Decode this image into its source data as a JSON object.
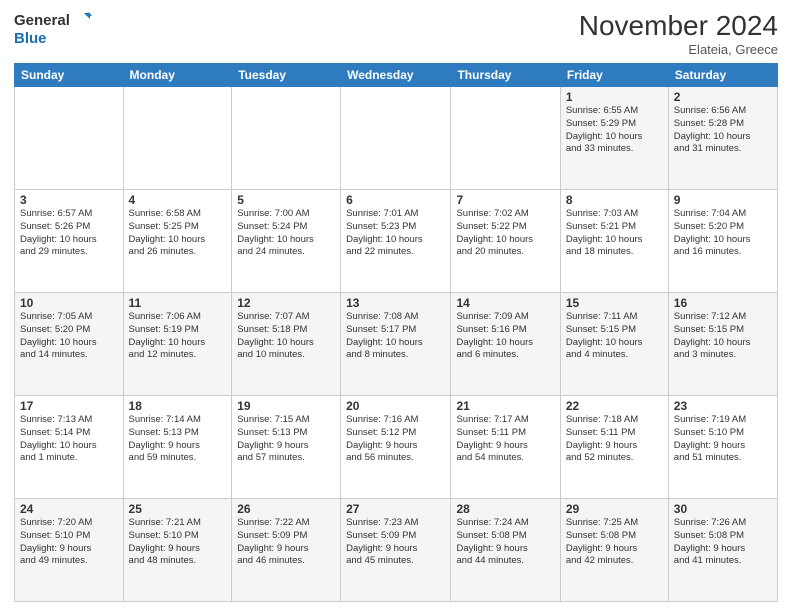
{
  "logo": {
    "line1": "General",
    "line2": "Blue"
  },
  "title": "November 2024",
  "location": "Elateia, Greece",
  "days_header": [
    "Sunday",
    "Monday",
    "Tuesday",
    "Wednesday",
    "Thursday",
    "Friday",
    "Saturday"
  ],
  "weeks": [
    [
      {
        "day": "",
        "info": ""
      },
      {
        "day": "",
        "info": ""
      },
      {
        "day": "",
        "info": ""
      },
      {
        "day": "",
        "info": ""
      },
      {
        "day": "",
        "info": ""
      },
      {
        "day": "1",
        "info": "Sunrise: 6:55 AM\nSunset: 5:29 PM\nDaylight: 10 hours\nand 33 minutes."
      },
      {
        "day": "2",
        "info": "Sunrise: 6:56 AM\nSunset: 5:28 PM\nDaylight: 10 hours\nand 31 minutes."
      }
    ],
    [
      {
        "day": "3",
        "info": "Sunrise: 6:57 AM\nSunset: 5:26 PM\nDaylight: 10 hours\nand 29 minutes."
      },
      {
        "day": "4",
        "info": "Sunrise: 6:58 AM\nSunset: 5:25 PM\nDaylight: 10 hours\nand 26 minutes."
      },
      {
        "day": "5",
        "info": "Sunrise: 7:00 AM\nSunset: 5:24 PM\nDaylight: 10 hours\nand 24 minutes."
      },
      {
        "day": "6",
        "info": "Sunrise: 7:01 AM\nSunset: 5:23 PM\nDaylight: 10 hours\nand 22 minutes."
      },
      {
        "day": "7",
        "info": "Sunrise: 7:02 AM\nSunset: 5:22 PM\nDaylight: 10 hours\nand 20 minutes."
      },
      {
        "day": "8",
        "info": "Sunrise: 7:03 AM\nSunset: 5:21 PM\nDaylight: 10 hours\nand 18 minutes."
      },
      {
        "day": "9",
        "info": "Sunrise: 7:04 AM\nSunset: 5:20 PM\nDaylight: 10 hours\nand 16 minutes."
      }
    ],
    [
      {
        "day": "10",
        "info": "Sunrise: 7:05 AM\nSunset: 5:20 PM\nDaylight: 10 hours\nand 14 minutes."
      },
      {
        "day": "11",
        "info": "Sunrise: 7:06 AM\nSunset: 5:19 PM\nDaylight: 10 hours\nand 12 minutes."
      },
      {
        "day": "12",
        "info": "Sunrise: 7:07 AM\nSunset: 5:18 PM\nDaylight: 10 hours\nand 10 minutes."
      },
      {
        "day": "13",
        "info": "Sunrise: 7:08 AM\nSunset: 5:17 PM\nDaylight: 10 hours\nand 8 minutes."
      },
      {
        "day": "14",
        "info": "Sunrise: 7:09 AM\nSunset: 5:16 PM\nDaylight: 10 hours\nand 6 minutes."
      },
      {
        "day": "15",
        "info": "Sunrise: 7:11 AM\nSunset: 5:15 PM\nDaylight: 10 hours\nand 4 minutes."
      },
      {
        "day": "16",
        "info": "Sunrise: 7:12 AM\nSunset: 5:15 PM\nDaylight: 10 hours\nand 3 minutes."
      }
    ],
    [
      {
        "day": "17",
        "info": "Sunrise: 7:13 AM\nSunset: 5:14 PM\nDaylight: 10 hours\nand 1 minute."
      },
      {
        "day": "18",
        "info": "Sunrise: 7:14 AM\nSunset: 5:13 PM\nDaylight: 9 hours\nand 59 minutes."
      },
      {
        "day": "19",
        "info": "Sunrise: 7:15 AM\nSunset: 5:13 PM\nDaylight: 9 hours\nand 57 minutes."
      },
      {
        "day": "20",
        "info": "Sunrise: 7:16 AM\nSunset: 5:12 PM\nDaylight: 9 hours\nand 56 minutes."
      },
      {
        "day": "21",
        "info": "Sunrise: 7:17 AM\nSunset: 5:11 PM\nDaylight: 9 hours\nand 54 minutes."
      },
      {
        "day": "22",
        "info": "Sunrise: 7:18 AM\nSunset: 5:11 PM\nDaylight: 9 hours\nand 52 minutes."
      },
      {
        "day": "23",
        "info": "Sunrise: 7:19 AM\nSunset: 5:10 PM\nDaylight: 9 hours\nand 51 minutes."
      }
    ],
    [
      {
        "day": "24",
        "info": "Sunrise: 7:20 AM\nSunset: 5:10 PM\nDaylight: 9 hours\nand 49 minutes."
      },
      {
        "day": "25",
        "info": "Sunrise: 7:21 AM\nSunset: 5:10 PM\nDaylight: 9 hours\nand 48 minutes."
      },
      {
        "day": "26",
        "info": "Sunrise: 7:22 AM\nSunset: 5:09 PM\nDaylight: 9 hours\nand 46 minutes."
      },
      {
        "day": "27",
        "info": "Sunrise: 7:23 AM\nSunset: 5:09 PM\nDaylight: 9 hours\nand 45 minutes."
      },
      {
        "day": "28",
        "info": "Sunrise: 7:24 AM\nSunset: 5:08 PM\nDaylight: 9 hours\nand 44 minutes."
      },
      {
        "day": "29",
        "info": "Sunrise: 7:25 AM\nSunset: 5:08 PM\nDaylight: 9 hours\nand 42 minutes."
      },
      {
        "day": "30",
        "info": "Sunrise: 7:26 AM\nSunset: 5:08 PM\nDaylight: 9 hours\nand 41 minutes."
      }
    ]
  ]
}
